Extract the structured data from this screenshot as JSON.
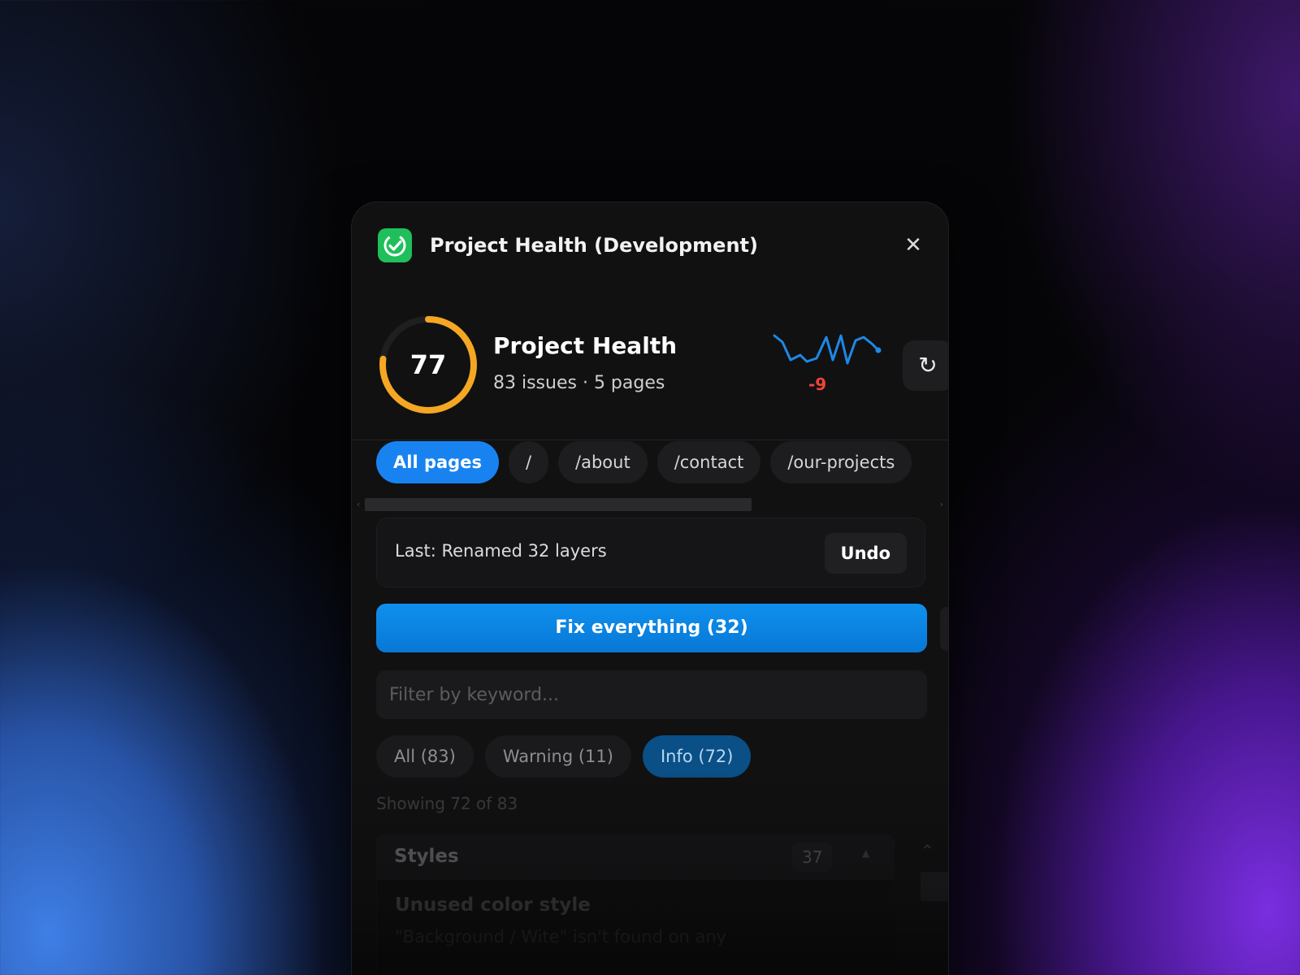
{
  "window": {
    "title": "Project Health (Development)",
    "app_icon": "check-circle-icon",
    "close_icon": "close-icon",
    "close_glyph": "✕"
  },
  "health": {
    "score": "77",
    "score_value": 77,
    "ring_color": "#f5a623",
    "title": "Project Health",
    "subtitle": "83 issues · 5 pages",
    "trend_delta": "-9",
    "trend_color": "#1e88e5",
    "delta_color": "#f04438",
    "refresh_icon": "refresh-icon",
    "refresh_glyph": "↻"
  },
  "pages": {
    "tabs": [
      {
        "label": "All pages",
        "active": true
      },
      {
        "label": "/",
        "active": false
      },
      {
        "label": "/about",
        "active": false
      },
      {
        "label": "/contact",
        "active": false
      },
      {
        "label": "/our-projects",
        "active": false
      }
    ]
  },
  "last_action": {
    "text": "Last: Renamed 32 layers",
    "undo_label": "Undo"
  },
  "fix_button": {
    "label": "Fix everything (32)",
    "color": "#1184e8"
  },
  "filter": {
    "placeholder": "Filter by keyword...",
    "value": ""
  },
  "severity": {
    "options": [
      {
        "label": "All (83)",
        "active": false
      },
      {
        "label": "Warning (11)",
        "active": false
      },
      {
        "label": "Info (72)",
        "active": true
      }
    ]
  },
  "results": {
    "showing": "Showing 72 of 83"
  },
  "groups": [
    {
      "name": "Styles",
      "count": "37",
      "caret_glyph": "▲",
      "issues": [
        {
          "title": "Unused color style",
          "description": "\"Background / Wite\" isn't found on any"
        }
      ]
    }
  ],
  "scroll": {
    "up_glyph": "⌃"
  }
}
